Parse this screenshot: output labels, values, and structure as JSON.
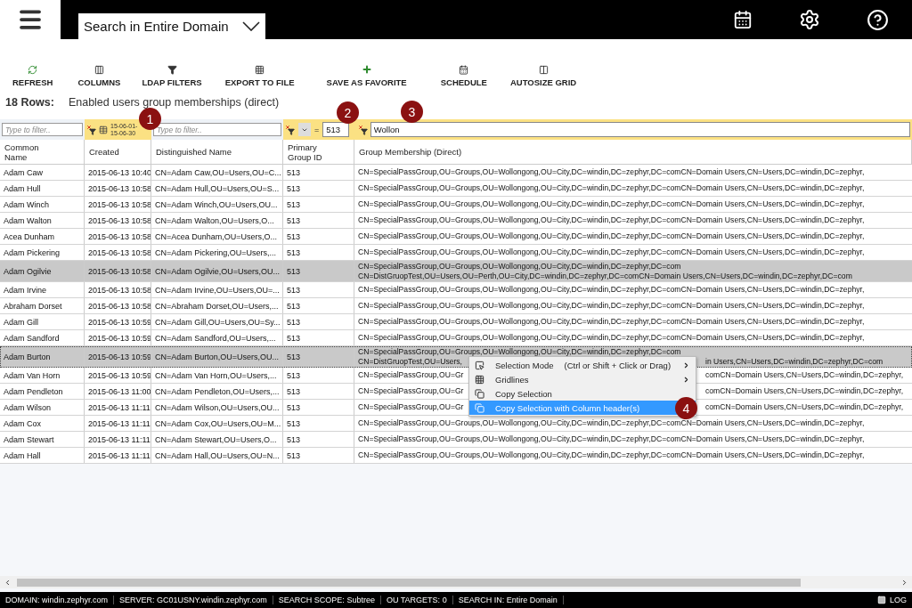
{
  "header": {
    "scope_dropdown": {
      "label": "Search in Entire Domain"
    }
  },
  "toolbar": [
    {
      "label": "REFRESH",
      "kind": "refresh"
    },
    {
      "label": "COLUMNS",
      "kind": "columns"
    },
    {
      "label": "LDAP FILTERS",
      "kind": "filter"
    },
    {
      "label": "EXPORT TO FILE",
      "kind": "export"
    },
    {
      "label": "SAVE AS FAVORITE",
      "kind": "favorite"
    },
    {
      "label": "SCHEDULE",
      "kind": "schedule"
    },
    {
      "label": "AUTOSIZE GRID",
      "kind": "autosize"
    }
  ],
  "summary": {
    "row_count": "18 Rows:",
    "title": "Enabled users group memberships (direct)"
  },
  "filters": [
    {
      "kind": "text",
      "placeholder": "Type to filter..",
      "active": false
    },
    {
      "kind": "date",
      "lines": [
        "15-06-01-",
        "15-06-30"
      ],
      "active": true
    },
    {
      "kind": "text",
      "placeholder": "Type to filter..",
      "active": false
    },
    {
      "kind": "compare",
      "operator": "=",
      "value": "513",
      "active": true
    },
    {
      "kind": "value",
      "value": "Wollon",
      "active": true
    }
  ],
  "table": {
    "columns": [
      [
        "Common",
        "Name"
      ],
      [
        "Created"
      ],
      [
        "Distinguished Name"
      ],
      [
        "Primary",
        "Group ID"
      ],
      [
        "Group Membership (Direct)"
      ]
    ],
    "rows": [
      {
        "name": "Adam Caw",
        "created": "2015-06-13 10:40",
        "dn": "CN=Adam Caw,OU=Users,OU=C...",
        "group_id": "513",
        "membership": [
          [
            "CN=SpecialPassGroup,OU=Groups,OU=Wollongong,OU=City,DC=windin,DC=zephyr,DC=comCN=Domain Users,CN=Users,DC=windin,DC=zephyr,"
          ]
        ],
        "selected": false,
        "focused": false
      },
      {
        "name": "Adam Hull",
        "created": "2015-06-13 10:58",
        "dn": "CN=Adam Hull,OU=Users,OU=S...",
        "group_id": "513",
        "membership": [
          [
            "CN=SpecialPassGroup,OU=Groups,OU=Wollongong,OU=City,DC=windin,DC=zephyr,DC=comCN=Domain Users,CN=Users,DC=windin,DC=zephyr,"
          ]
        ],
        "selected": false,
        "focused": false
      },
      {
        "name": "Adam Winch",
        "created": "2015-06-13 10:58",
        "dn": "CN=Adam Winch,OU=Users,OU...",
        "group_id": "513",
        "membership": [
          [
            "CN=SpecialPassGroup,OU=Groups,OU=Wollongong,OU=City,DC=windin,DC=zephyr,DC=comCN=Domain Users,CN=Users,DC=windin,DC=zephyr,"
          ]
        ],
        "selected": false,
        "focused": false
      },
      {
        "name": "Adam Walton",
        "created": "2015-06-13 10:58",
        "dn": "CN=Adam Walton,OU=Users,O...",
        "group_id": "513",
        "membership": [
          [
            "CN=SpecialPassGroup,OU=Groups,OU=Wollongong,OU=City,DC=windin,DC=zephyr,DC=comCN=Domain Users,CN=Users,DC=windin,DC=zephyr,"
          ]
        ],
        "selected": false,
        "focused": false
      },
      {
        "name": "Acea Dunham",
        "created": "2015-06-13 10:58",
        "dn": "CN=Acea Dunham,OU=Users,O...",
        "group_id": "513",
        "membership": [
          [
            "CN=SpecialPassGroup,OU=Groups,OU=Wollongong,OU=City,DC=windin,DC=zephyr,DC=comCN=Domain Users,CN=Users,DC=windin,DC=zephyr,"
          ]
        ],
        "selected": false,
        "focused": false
      },
      {
        "name": "Adam Pickering",
        "created": "2015-06-13 10:58",
        "dn": "CN=Adam Pickering,OU=Users,...",
        "group_id": "513",
        "membership": [
          [
            "CN=SpecialPassGroup,OU=Groups,OU=Wollongong,OU=City,DC=windin,DC=zephyr,DC=comCN=Domain Users,CN=Users,DC=windin,DC=zephyr,"
          ]
        ],
        "selected": false,
        "focused": false
      },
      {
        "name": "Adam Ogilvie",
        "created": "2015-06-13 10:58",
        "dn": "CN=Adam Ogilvie,OU=Users,OU...",
        "group_id": "513",
        "membership": [
          [
            "CN=SpecialPassGroup,OU=Groups,OU=Wollongong,OU=City,DC=windin,DC=zephyr,DC=com"
          ],
          [
            "CN=DistGruopTest,OU=Users,OU=Perth,OU=City,DC=windin,DC=zephyr,DC=comCN=Domain Users,CN=Users,DC=windin,DC=zephyr,DC=com"
          ]
        ],
        "selected": true,
        "focused": false
      },
      {
        "name": "Adam Irvine",
        "created": "2015-06-13 10:58",
        "dn": "CN=Adam Irvine,OU=Users,OU=...",
        "group_id": "513",
        "membership": [
          [
            "CN=SpecialPassGroup,OU=Groups,OU=Wollongong,OU=City,DC=windin,DC=zephyr,DC=comCN=Domain Users,CN=Users,DC=windin,DC=zephyr,"
          ]
        ],
        "selected": false,
        "focused": false
      },
      {
        "name": "Abraham Dorset",
        "created": "2015-06-13 10:58",
        "dn": "CN=Abraham Dorset,OU=Users,...",
        "group_id": "513",
        "membership": [
          [
            "CN=SpecialPassGroup,OU=Groups,OU=Wollongong,OU=City,DC=windin,DC=zephyr,DC=comCN=Domain Users,CN=Users,DC=windin,DC=zephyr,"
          ]
        ],
        "selected": false,
        "focused": false
      },
      {
        "name": "Adam Gill",
        "created": "2015-06-13 10:59",
        "dn": "CN=Adam Gill,OU=Users,OU=Sy...",
        "group_id": "513",
        "membership": [
          [
            "CN=SpecialPassGroup,OU=Groups,OU=Wollongong,OU=City,DC=windin,DC=zephyr,DC=comCN=Domain Users,CN=Users,DC=windin,DC=zephyr,"
          ]
        ],
        "selected": false,
        "focused": false
      },
      {
        "name": "Adam Sandford",
        "created": "2015-06-13 10:59",
        "dn": "CN=Adam Sandford,OU=Users,...",
        "group_id": "513",
        "membership": [
          [
            "CN=SpecialPassGroup,OU=Groups,OU=Wollongong,OU=City,DC=windin,DC=zephyr,DC=comCN=Domain Users,CN=Users,DC=windin,DC=zephyr,"
          ]
        ],
        "selected": false,
        "focused": false
      },
      {
        "name": "Adam Burton",
        "created": "2015-06-13 10:59",
        "dn": "CN=Adam Burton,OU=Users,OU...",
        "group_id": "513",
        "membership": [
          [
            "CN=SpecialPassGroup,OU=Groups,OU=Wollongong,OU=City,DC=windin,DC=zephyr,DC=com"
          ],
          [
            "CN=DistGruopTest,OU=Users,",
            "in Users,CN=Users,DC=windin,DC=zephyr,DC=com"
          ]
        ],
        "selected": true,
        "focused": true
      },
      {
        "name": "Adam Van Horn",
        "created": "2015-06-13 10:59",
        "dn": "CN=Adam Van Horn,OU=Users,...",
        "group_id": "513",
        "membership": [
          [
            "CN=SpecialPassGroup,OU=Gr",
            "comCN=Domain Users,CN=Users,DC=windin,DC=zephyr,"
          ]
        ],
        "selected": false,
        "focused": false
      },
      {
        "name": "Adam Pendleton",
        "created": "2015-06-13 11:00",
        "dn": "CN=Adam Pendleton,OU=Users,...",
        "group_id": "513",
        "membership": [
          [
            "CN=SpecialPassGroup,OU=Gr",
            "comCN=Domain Users,CN=Users,DC=windin,DC=zephyr,"
          ]
        ],
        "selected": false,
        "focused": false
      },
      {
        "name": "Adam Wilson",
        "created": "2015-06-13 11:11",
        "dn": "CN=Adam Wilson,OU=Users,OU...",
        "group_id": "513",
        "membership": [
          [
            "CN=SpecialPassGroup,OU=Gr",
            "comCN=Domain Users,CN=Users,DC=windin,DC=zephyr,"
          ]
        ],
        "selected": false,
        "focused": false
      },
      {
        "name": "Adam Cox",
        "created": "2015-06-13 11:11",
        "dn": "CN=Adam Cox,OU=Users,OU=M...",
        "group_id": "513",
        "membership": [
          [
            "CN=SpecialPassGroup,OU=Groups,OU=Wollongong,OU=City,DC=windin,DC=zephyr,DC=comCN=Domain Users,CN=Users,DC=windin,DC=zephyr,"
          ]
        ],
        "selected": false,
        "focused": false
      },
      {
        "name": "Adam Stewart",
        "created": "2015-06-13 11:11",
        "dn": "CN=Adam Stewart,OU=Users,O...",
        "group_id": "513",
        "membership": [
          [
            "CN=SpecialPassGroup,OU=Groups,OU=Wollongong,OU=City,DC=windin,DC=zephyr,DC=comCN=Domain Users,CN=Users,DC=windin,DC=zephyr,"
          ]
        ],
        "selected": false,
        "focused": false
      },
      {
        "name": "Adam Hall",
        "created": "2015-06-13 11:11",
        "dn": "CN=Adam Hall,OU=Users,OU=N...",
        "group_id": "513",
        "membership": [
          [
            "CN=SpecialPassGroup,OU=Groups,OU=Wollongong,OU=City,DC=windin,DC=zephyr,DC=comCN=Domain Users,CN=Users,DC=windin,DC=zephyr,"
          ]
        ],
        "selected": false,
        "focused": false
      }
    ]
  },
  "context_menu": [
    {
      "kind": "mode",
      "label": "Selection Mode",
      "shortcut": "(Ctrl or Shift + Click or Drag)",
      "submenu": true,
      "selected": false
    },
    {
      "kind": "grid",
      "label": "Gridlines",
      "submenu": true,
      "selected": false
    },
    {
      "kind": "copy",
      "label": "Copy Selection",
      "submenu": false,
      "selected": false
    },
    {
      "kind": "copy",
      "label": "Copy Selection with Column header(s)",
      "submenu": false,
      "selected": true
    }
  ],
  "callouts": [
    "1",
    "2",
    "3",
    "4"
  ],
  "status_bar": [
    {
      "label": "DOMAIN:",
      "value": "windin.zephyr.com"
    },
    {
      "label": "SERVER:",
      "value": "GC01USNY.windin.zephyr.com"
    },
    {
      "label": "SEARCH SCOPE:",
      "value": "Subtree"
    },
    {
      "label": "OU TARGETS:",
      "value": "0"
    },
    {
      "label": "SEARCH IN:",
      "value": "Entire Domain"
    }
  ],
  "log_button": {
    "label": "LOG"
  }
}
